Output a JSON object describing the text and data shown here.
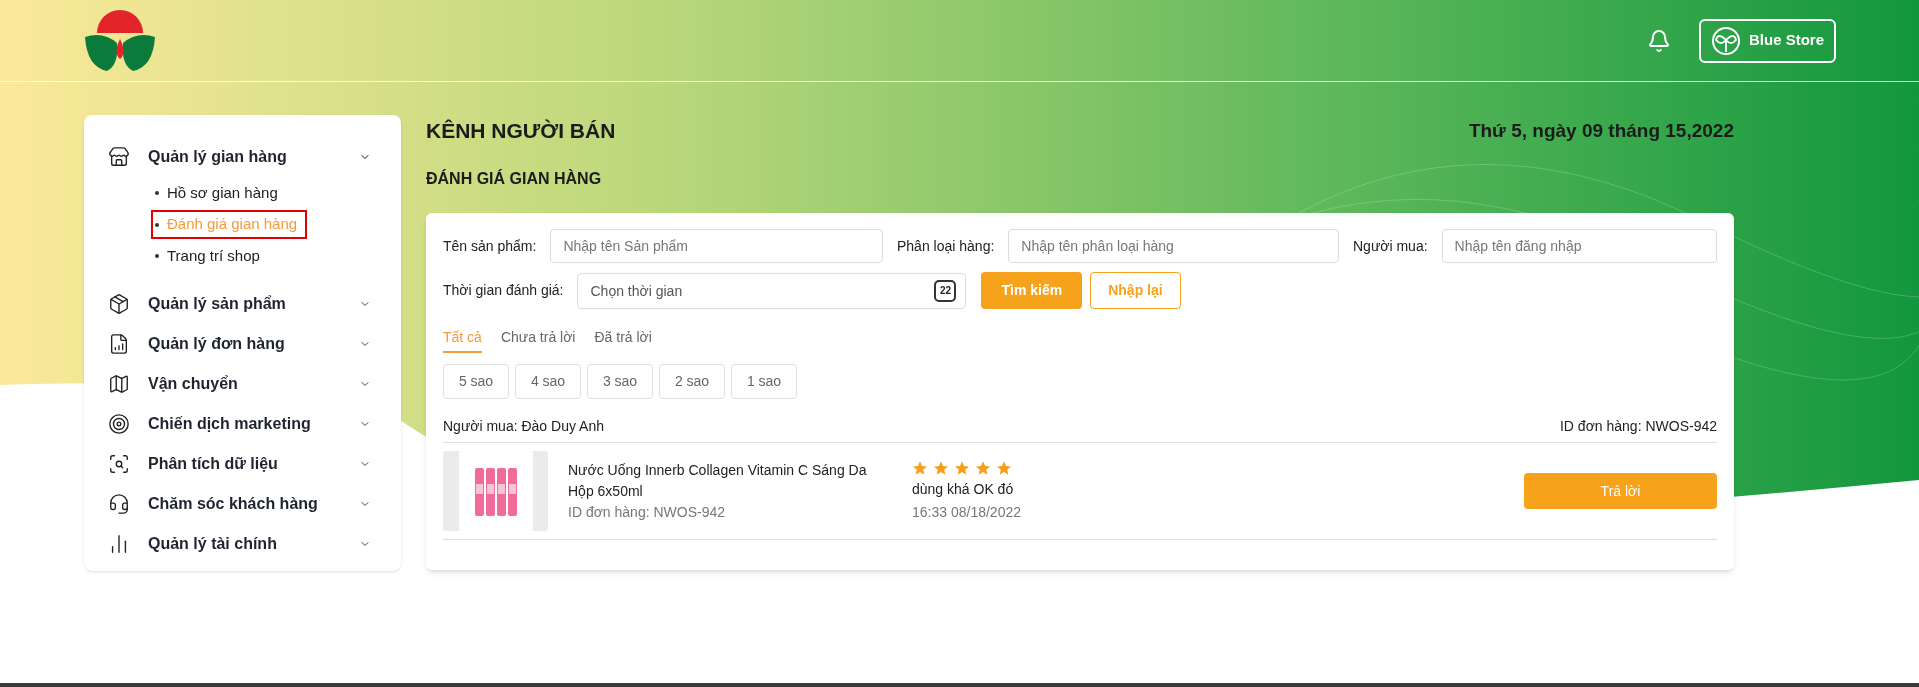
{
  "header": {
    "store_button": "Blue Store"
  },
  "sidebar": {
    "items": [
      {
        "label": "Quản lý gian hàng",
        "expanded": true,
        "children": [
          {
            "label": "Hồ sơ gian hàng",
            "selected": false
          },
          {
            "label": "Đánh giá gian hàng",
            "selected": true
          },
          {
            "label": "Trang trí shop",
            "selected": false
          }
        ]
      },
      {
        "label": "Quản lý sản phẩm",
        "expanded": false
      },
      {
        "label": "Quản lý đơn hàng",
        "expanded": false
      },
      {
        "label": "Vận chuyển",
        "expanded": false
      },
      {
        "label": "Chiến dịch marketing",
        "expanded": false
      },
      {
        "label": "Phân tích dữ liệu",
        "expanded": false
      },
      {
        "label": "Chăm sóc khách hàng",
        "expanded": false
      },
      {
        "label": "Quản lý tài chính",
        "expanded": false
      }
    ]
  },
  "page": {
    "title": "KÊNH NGƯỜI BÁN",
    "date": "Thứ 5, ngày 09 tháng 15,2022",
    "section_title": "ĐÁNH GIÁ GIAN HÀNG"
  },
  "filters": {
    "fields": [
      {
        "label": "Tên sản phẩm:",
        "placeholder": "Nhập tên Sản phẩm"
      },
      {
        "label": "Phân loại hàng:",
        "placeholder": "Nhập tên phân loại hàng"
      },
      {
        "label": "Người mua:",
        "placeholder": "Nhập tên đăng nhập"
      }
    ],
    "date_field": {
      "label": "Thời gian đánh giá:",
      "placeholder": "Chọn thời gian",
      "icon_text": "22"
    },
    "search_button": "Tìm kiếm",
    "reset_button": "Nhập lại"
  },
  "tabs": [
    {
      "label": "Tất cả",
      "selected": true
    },
    {
      "label": "Chưa trả lời",
      "selected": false
    },
    {
      "label": "Đã trả lời",
      "selected": false
    }
  ],
  "star_filters": [
    {
      "label": "5 sao",
      "selected": false
    },
    {
      "label": "4 sao",
      "selected": false
    },
    {
      "label": "3 sao",
      "selected": false
    },
    {
      "label": "2 sao",
      "selected": false
    },
    {
      "label": "1 sao",
      "selected": false
    }
  ],
  "reviews": [
    {
      "buyer": "Người mua: Đào Duy Anh",
      "order_id": "ID đơn hàng: NWOS-942",
      "product_name": "Nước Uống Innerb Collagen Vitamin C Sáng Da Hộp 6x50ml",
      "product_order_id": "ID đơn hàng: NWOS-942",
      "stars": 5,
      "comment": "dùng khá OK đó",
      "time": "16:33 08/18/2022",
      "reply_button": "Trả lời"
    }
  ]
}
